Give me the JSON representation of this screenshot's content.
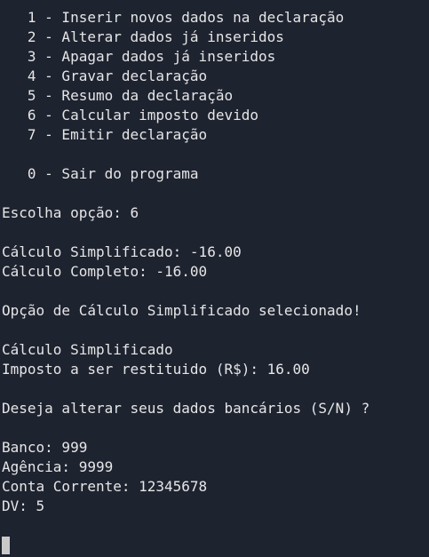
{
  "menu": {
    "items": [
      "   1 - Inserir novos dados na declaração",
      "   2 - Alterar dados já inseridos",
      "   3 - Apagar dados já inseridos",
      "   4 - Gravar declaração",
      "   5 - Resumo da declaração",
      "   6 - Calcular imposto devido",
      "   7 - Emitir declaração"
    ],
    "exit": "   0 - Sair do programa"
  },
  "prompt": "Escolha opção: 6",
  "calc": {
    "simplified": "Cálculo Simplificado: -16.00",
    "complete": "Cálculo Completo: -16.00"
  },
  "selected_message": "Opção de Cálculo Simplificado selecionado!",
  "result": {
    "title": "Cálculo Simplificado",
    "refund": "Imposto a ser restituido (R$): 16.00"
  },
  "bank_question": "Deseja alterar seus dados bancários (S/N) ?",
  "bank": {
    "banco": "Banco: 999",
    "agencia": "Agência: 9999",
    "conta": "Conta Corrente: 12345678",
    "dv": "DV: 5"
  }
}
